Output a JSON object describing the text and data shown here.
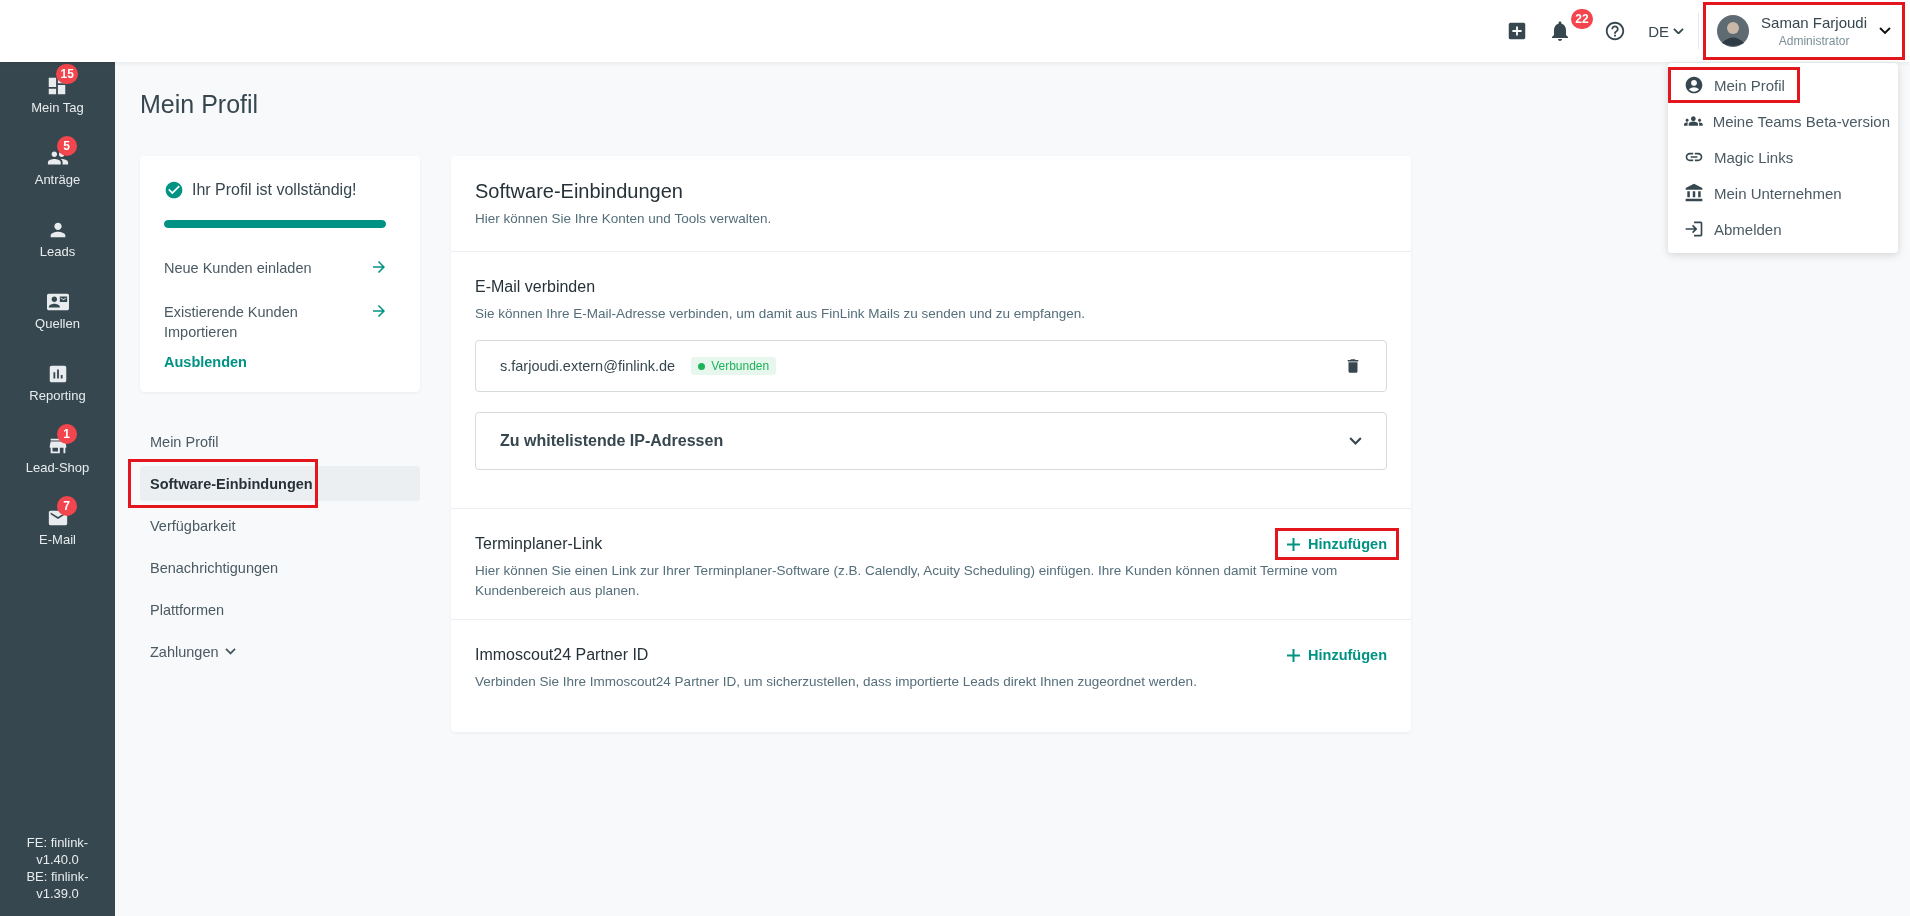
{
  "header": {
    "notifications": "22",
    "language": "DE",
    "user": {
      "name": "Saman Farjoudi",
      "role": "Administrator",
      "highlighted": true
    },
    "user_menu": [
      {
        "label": "Mein Profil",
        "highlighted": true
      },
      {
        "label": "Meine Teams Beta-version",
        "highlighted": false
      },
      {
        "label": "Magic Links",
        "highlighted": false
      },
      {
        "label": "Mein Unternehmen",
        "highlighted": false
      },
      {
        "label": "Abmelden",
        "highlighted": false
      }
    ]
  },
  "sidebar": {
    "items": [
      {
        "label": "Mein Tag",
        "badge": "15"
      },
      {
        "label": "Anträge",
        "badge": "5"
      },
      {
        "label": "Leads"
      },
      {
        "label": "Quellen"
      },
      {
        "label": "Reporting"
      },
      {
        "label": "Lead-Shop",
        "badge": "1"
      },
      {
        "label": "E-Mail",
        "badge": "7"
      }
    ],
    "versions": [
      "FE: finlink-v1.40.0",
      "BE: finlink-v1.39.0"
    ]
  },
  "page_title": "Mein Profil",
  "profile_card": {
    "title": "Ihr Profil ist vollständig!",
    "level": 1,
    "links": [
      "Neue Kunden einladen",
      "Existierende Kunden Importieren"
    ],
    "hide": "Ausblenden"
  },
  "nav": [
    {
      "label": "Mein Profil",
      "selected": false,
      "highlighted": false,
      "expandable": false
    },
    {
      "label": "Software-Einbindungen",
      "selected": true,
      "highlighted": true,
      "expandable": false
    },
    {
      "label": "Verfügbarkeit",
      "selected": false,
      "highlighted": false,
      "expandable": false
    },
    {
      "label": "Benachrichtigungen",
      "selected": false,
      "highlighted": false,
      "expandable": false
    },
    {
      "label": "Plattformen",
      "selected": false,
      "highlighted": false,
      "expandable": false
    },
    {
      "label": "Zahlungen",
      "selected": false,
      "highlighted": false,
      "expandable": true
    }
  ],
  "main": {
    "title": "Software-Einbindungen",
    "subtitle": "Hier können Sie Ihre Konten und Tools verwalten.",
    "email": {
      "title": "E-Mail verbinden",
      "description": "Sie können Ihre E-Mail-Adresse verbinden, um damit aus FinLink Mails zu senden und zu empfangen.",
      "account": {
        "address": "s.farjoudi.extern@finlink.de",
        "status": "Verbunden",
        "connected": true
      },
      "accordion": {
        "label": "Zu whitelistende IP-Adressen",
        "expanded": false
      }
    },
    "integrations": [
      {
        "title": "Terminplaner-Link",
        "description": "Hier können Sie einen Link zur Ihrer Terminplaner-Software (z.B. Calendly, Acuity Scheduling) einfügen. Ihre Kunden können damit Termine vom Kundenbereich aus planen.",
        "action": "Hinzufügen",
        "highlighted": true
      },
      {
        "title": "Immoscout24 Partner ID",
        "description": "Verbinden Sie Ihre Immoscout24 Partner ID, um sicherzustellen, dass importierte Leads direkt Ihnen zugeordnet werden.",
        "action": "Hinzufügen",
        "highlighted": false
      }
    ]
  }
}
